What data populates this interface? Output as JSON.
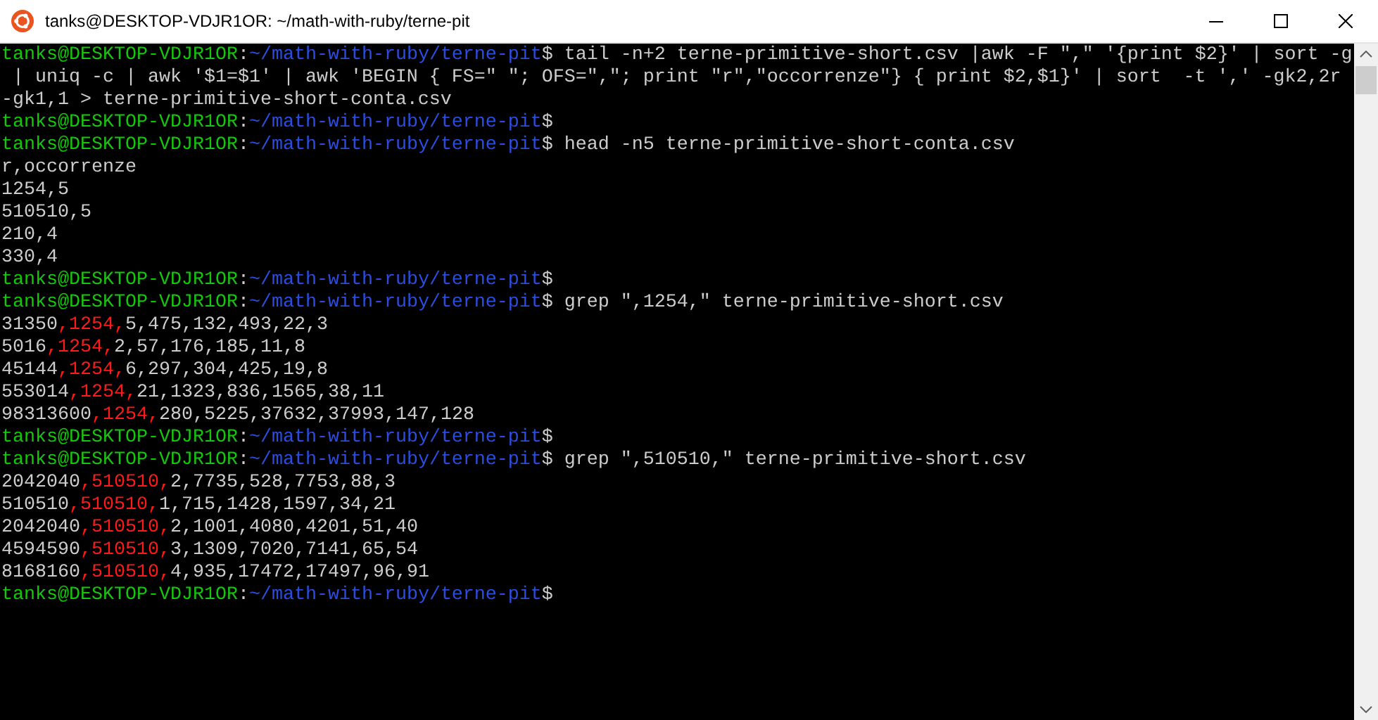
{
  "window": {
    "title": "tanks@DESKTOP-VDJR1OR: ~/math-with-ruby/terne-pit"
  },
  "lines": [
    {
      "kind": "prompt",
      "user": "tanks@DESKTOP-VDJR1OR",
      "separator": ":",
      "path": "~/math-with-ruby/terne-pit",
      "command": "$ tail -n+2 terne-primitive-short.csv |awk -F \",\" '{print $2}' | sort -g"
    },
    {
      "kind": "output",
      "text": " | uniq -c | awk '$1=$1' | awk 'BEGIN { FS=\" \"; OFS=\",\"; print \"r\",\"occorrenze\"} { print $2,$1}' | sort  -t ',' -gk2,2r"
    },
    {
      "kind": "output",
      "text": "-gk1,1 > terne-primitive-short-conta.csv"
    },
    {
      "kind": "prompt",
      "user": "tanks@DESKTOP-VDJR1OR",
      "separator": ":",
      "path": "~/math-with-ruby/terne-pit",
      "command": "$"
    },
    {
      "kind": "prompt",
      "user": "tanks@DESKTOP-VDJR1OR",
      "separator": ":",
      "path": "~/math-with-ruby/terne-pit",
      "command": "$ head -n5 terne-primitive-short-conta.csv"
    },
    {
      "kind": "output",
      "text": "r,occorrenze"
    },
    {
      "kind": "output",
      "text": "1254,5"
    },
    {
      "kind": "output",
      "text": "510510,5"
    },
    {
      "kind": "output",
      "text": "210,4"
    },
    {
      "kind": "output",
      "text": "330,4"
    },
    {
      "kind": "prompt",
      "user": "tanks@DESKTOP-VDJR1OR",
      "separator": ":",
      "path": "~/math-with-ruby/terne-pit",
      "command": "$"
    },
    {
      "kind": "prompt",
      "user": "tanks@DESKTOP-VDJR1OR",
      "separator": ":",
      "path": "~/math-with-ruby/terne-pit",
      "command": "$ grep \",1254,\" terne-primitive-short.csv"
    },
    {
      "kind": "match",
      "before": "31350",
      "match": ",1254,",
      "after": "5,475,132,493,22,3"
    },
    {
      "kind": "match",
      "before": "5016",
      "match": ",1254,",
      "after": "2,57,176,185,11,8"
    },
    {
      "kind": "match",
      "before": "45144",
      "match": ",1254,",
      "after": "6,297,304,425,19,8"
    },
    {
      "kind": "match",
      "before": "553014",
      "match": ",1254,",
      "after": "21,1323,836,1565,38,11"
    },
    {
      "kind": "match",
      "before": "98313600",
      "match": ",1254,",
      "after": "280,5225,37632,37993,147,128"
    },
    {
      "kind": "prompt",
      "user": "tanks@DESKTOP-VDJR1OR",
      "separator": ":",
      "path": "~/math-with-ruby/terne-pit",
      "command": "$"
    },
    {
      "kind": "prompt",
      "user": "tanks@DESKTOP-VDJR1OR",
      "separator": ":",
      "path": "~/math-with-ruby/terne-pit",
      "command": "$ grep \",510510,\" terne-primitive-short.csv"
    },
    {
      "kind": "match",
      "before": "2042040",
      "match": ",510510,",
      "after": "2,7735,528,7753,88,3"
    },
    {
      "kind": "match",
      "before": "510510",
      "match": ",510510,",
      "after": "1,715,1428,1597,34,21"
    },
    {
      "kind": "match",
      "before": "2042040",
      "match": ",510510,",
      "after": "2,1001,4080,4201,51,40"
    },
    {
      "kind": "match",
      "before": "4594590",
      "match": ",510510,",
      "after": "3,1309,7020,7141,65,54"
    },
    {
      "kind": "match",
      "before": "8168160",
      "match": ",510510,",
      "after": "4,935,17472,17497,96,91"
    },
    {
      "kind": "prompt",
      "user": "tanks@DESKTOP-VDJR1OR",
      "separator": ":",
      "path": "~/math-with-ruby/terne-pit",
      "command": "$"
    }
  ]
}
